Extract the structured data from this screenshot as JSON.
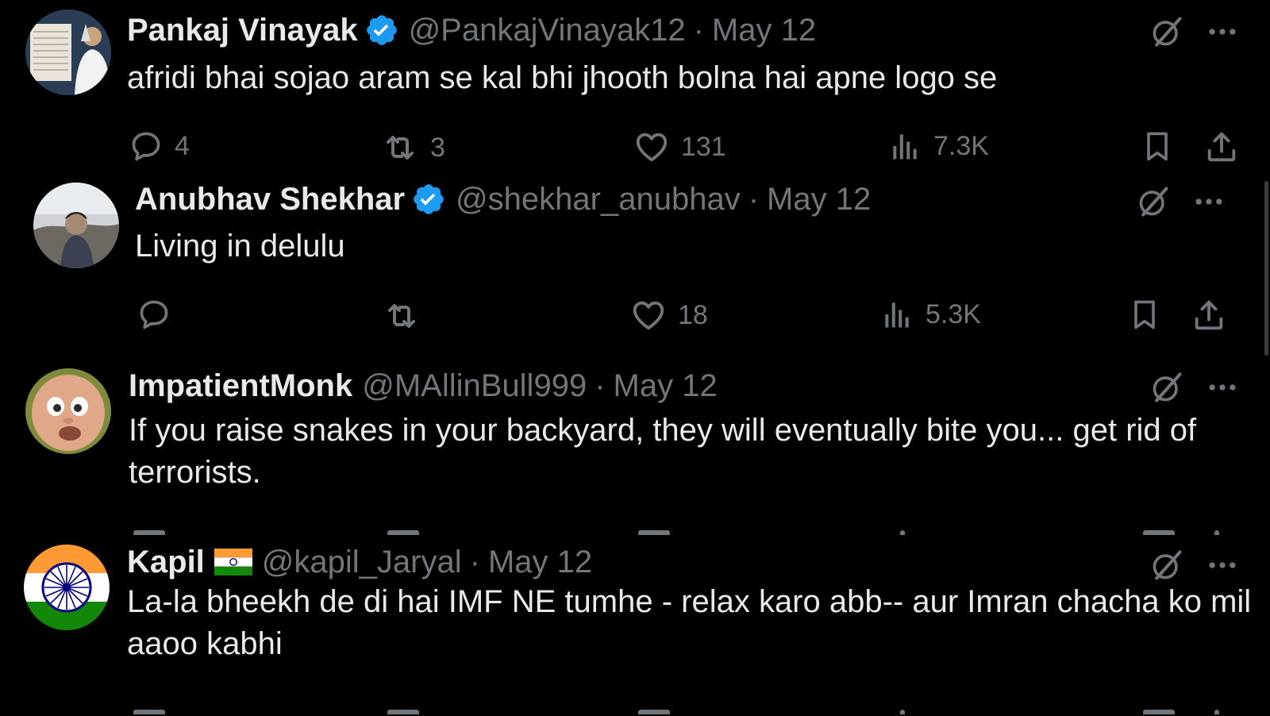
{
  "colors": {
    "background": "#000000",
    "text": "#e7e9ea",
    "muted": "#71767b",
    "verified": "#1d9bf0"
  },
  "tweets": [
    {
      "name": "Pankaj Vinayak",
      "verified": true,
      "handle": "@PankajVinayak12",
      "separator": "·",
      "date": "May 12",
      "text": "afridi bhai sojao aram se kal bhi jhooth bolna hai apne logo se",
      "replies": "4",
      "reposts": "3",
      "likes": "131",
      "views": "7.3K"
    },
    {
      "name": "Anubhav Shekhar",
      "verified": true,
      "handle": "@shekhar_anubhav",
      "separator": "·",
      "date": "May 12",
      "text": "Living in delulu",
      "replies": "",
      "reposts": "",
      "likes": "18",
      "views": "5.3K"
    },
    {
      "name": "ImpatientMonk",
      "verified": false,
      "handle": "@MAllinBull999",
      "separator": "·",
      "date": "May 12",
      "text": "If you raise snakes in your backyard, they will eventually bite you... get rid of terrorists."
    },
    {
      "name": "Kapil",
      "flag_icon": "india-flag-icon",
      "handle": "@kapil_Jaryal",
      "separator": "·",
      "date": "May 12",
      "text": "La-la bheekh de di hai IMF NE tumhe - relax karo abb-- aur Imran chacha ko mil aaoo kabhi"
    }
  ]
}
